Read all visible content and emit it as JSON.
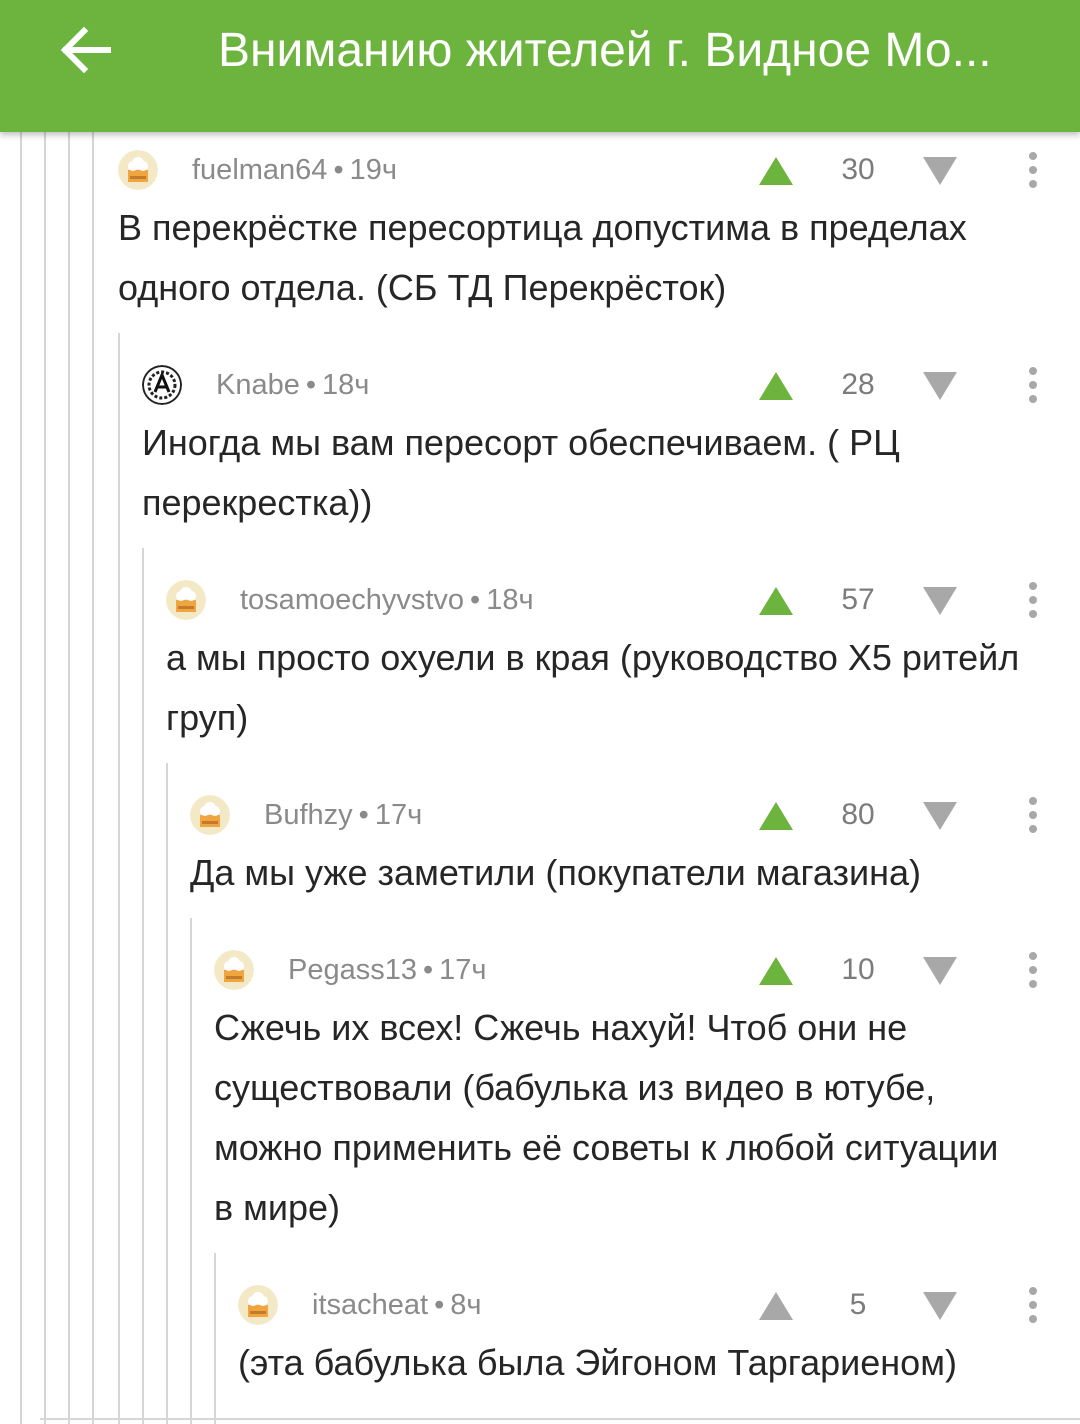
{
  "header": {
    "title": "Вниманию жителей г. Видное Мо...",
    "back_icon": "arrow-left-icon",
    "background": "#6db43f"
  },
  "colors": {
    "upvote_active": "#6db43f",
    "upvote_neutral": "#a8a8a8",
    "downvote": "#a8a8a8",
    "meta_text": "#8a8a8a"
  },
  "comments": [
    {
      "author": "fuelman64",
      "time": "19ч",
      "rating": "30",
      "text": "В перекрёстке пересортица допустима в пределах одного отдела. (СБ ТД Перекрёсток)",
      "avatar": "default-chef-avatar",
      "upvoted": true
    },
    {
      "author": "Knabe",
      "time": "18ч",
      "rating": "28",
      "text": "Иногда мы вам пересорт обеспечиваем. ( РЦ перекрестка))",
      "avatar": "custom-emblem-avatar",
      "upvoted": true
    },
    {
      "author": "tosamoechyvstvo",
      "time": "18ч",
      "rating": "57",
      "text": "а мы просто охуели в края (руководство Х5 ритейл груп)",
      "avatar": "default-chef-avatar",
      "upvoted": true
    },
    {
      "author": "Bufhzy",
      "time": "17ч",
      "rating": "80",
      "text": "Да мы уже заметили (покупатели магазина)",
      "avatar": "default-chef-avatar",
      "upvoted": true
    },
    {
      "author": "Pegass13",
      "time": "17ч",
      "rating": "10",
      "text": "Сжечь их всех! Сжечь нахуй! Чтоб они не существовали (бабулька из видео в ютубе, можно применить её советы к любой ситуации в мире)",
      "avatar": "default-chef-avatar",
      "upvoted": true
    },
    {
      "author": "itsacheat",
      "time": "8ч",
      "rating": "5",
      "text": "(эта бабулька была Эйгоном Таргариеном)",
      "avatar": "default-chef-avatar",
      "upvoted": false
    }
  ]
}
